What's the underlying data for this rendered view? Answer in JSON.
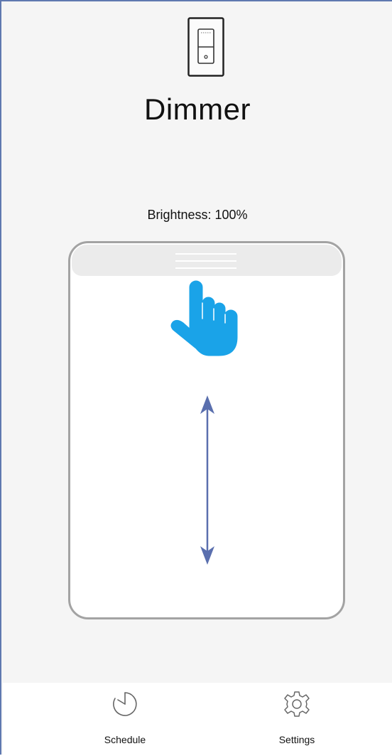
{
  "header": {
    "device_icon": "wall-dimmer-switch-icon",
    "title": "Dimmer"
  },
  "status": {
    "brightness_text": "Brightness: 100%",
    "brightness_percent": 100
  },
  "slider_panel": {
    "gesture_icon": "pointing-hand-icon",
    "direction_icon": "vertical-double-arrow-icon",
    "colors": {
      "hand": "#1aa3e8",
      "arrow": "#5a6fae",
      "panel_border": "#a3a3a3"
    }
  },
  "tabbar": {
    "items": [
      {
        "label": "Schedule",
        "icon": "timer-icon"
      },
      {
        "label": "Settings",
        "icon": "gear-icon"
      }
    ]
  }
}
